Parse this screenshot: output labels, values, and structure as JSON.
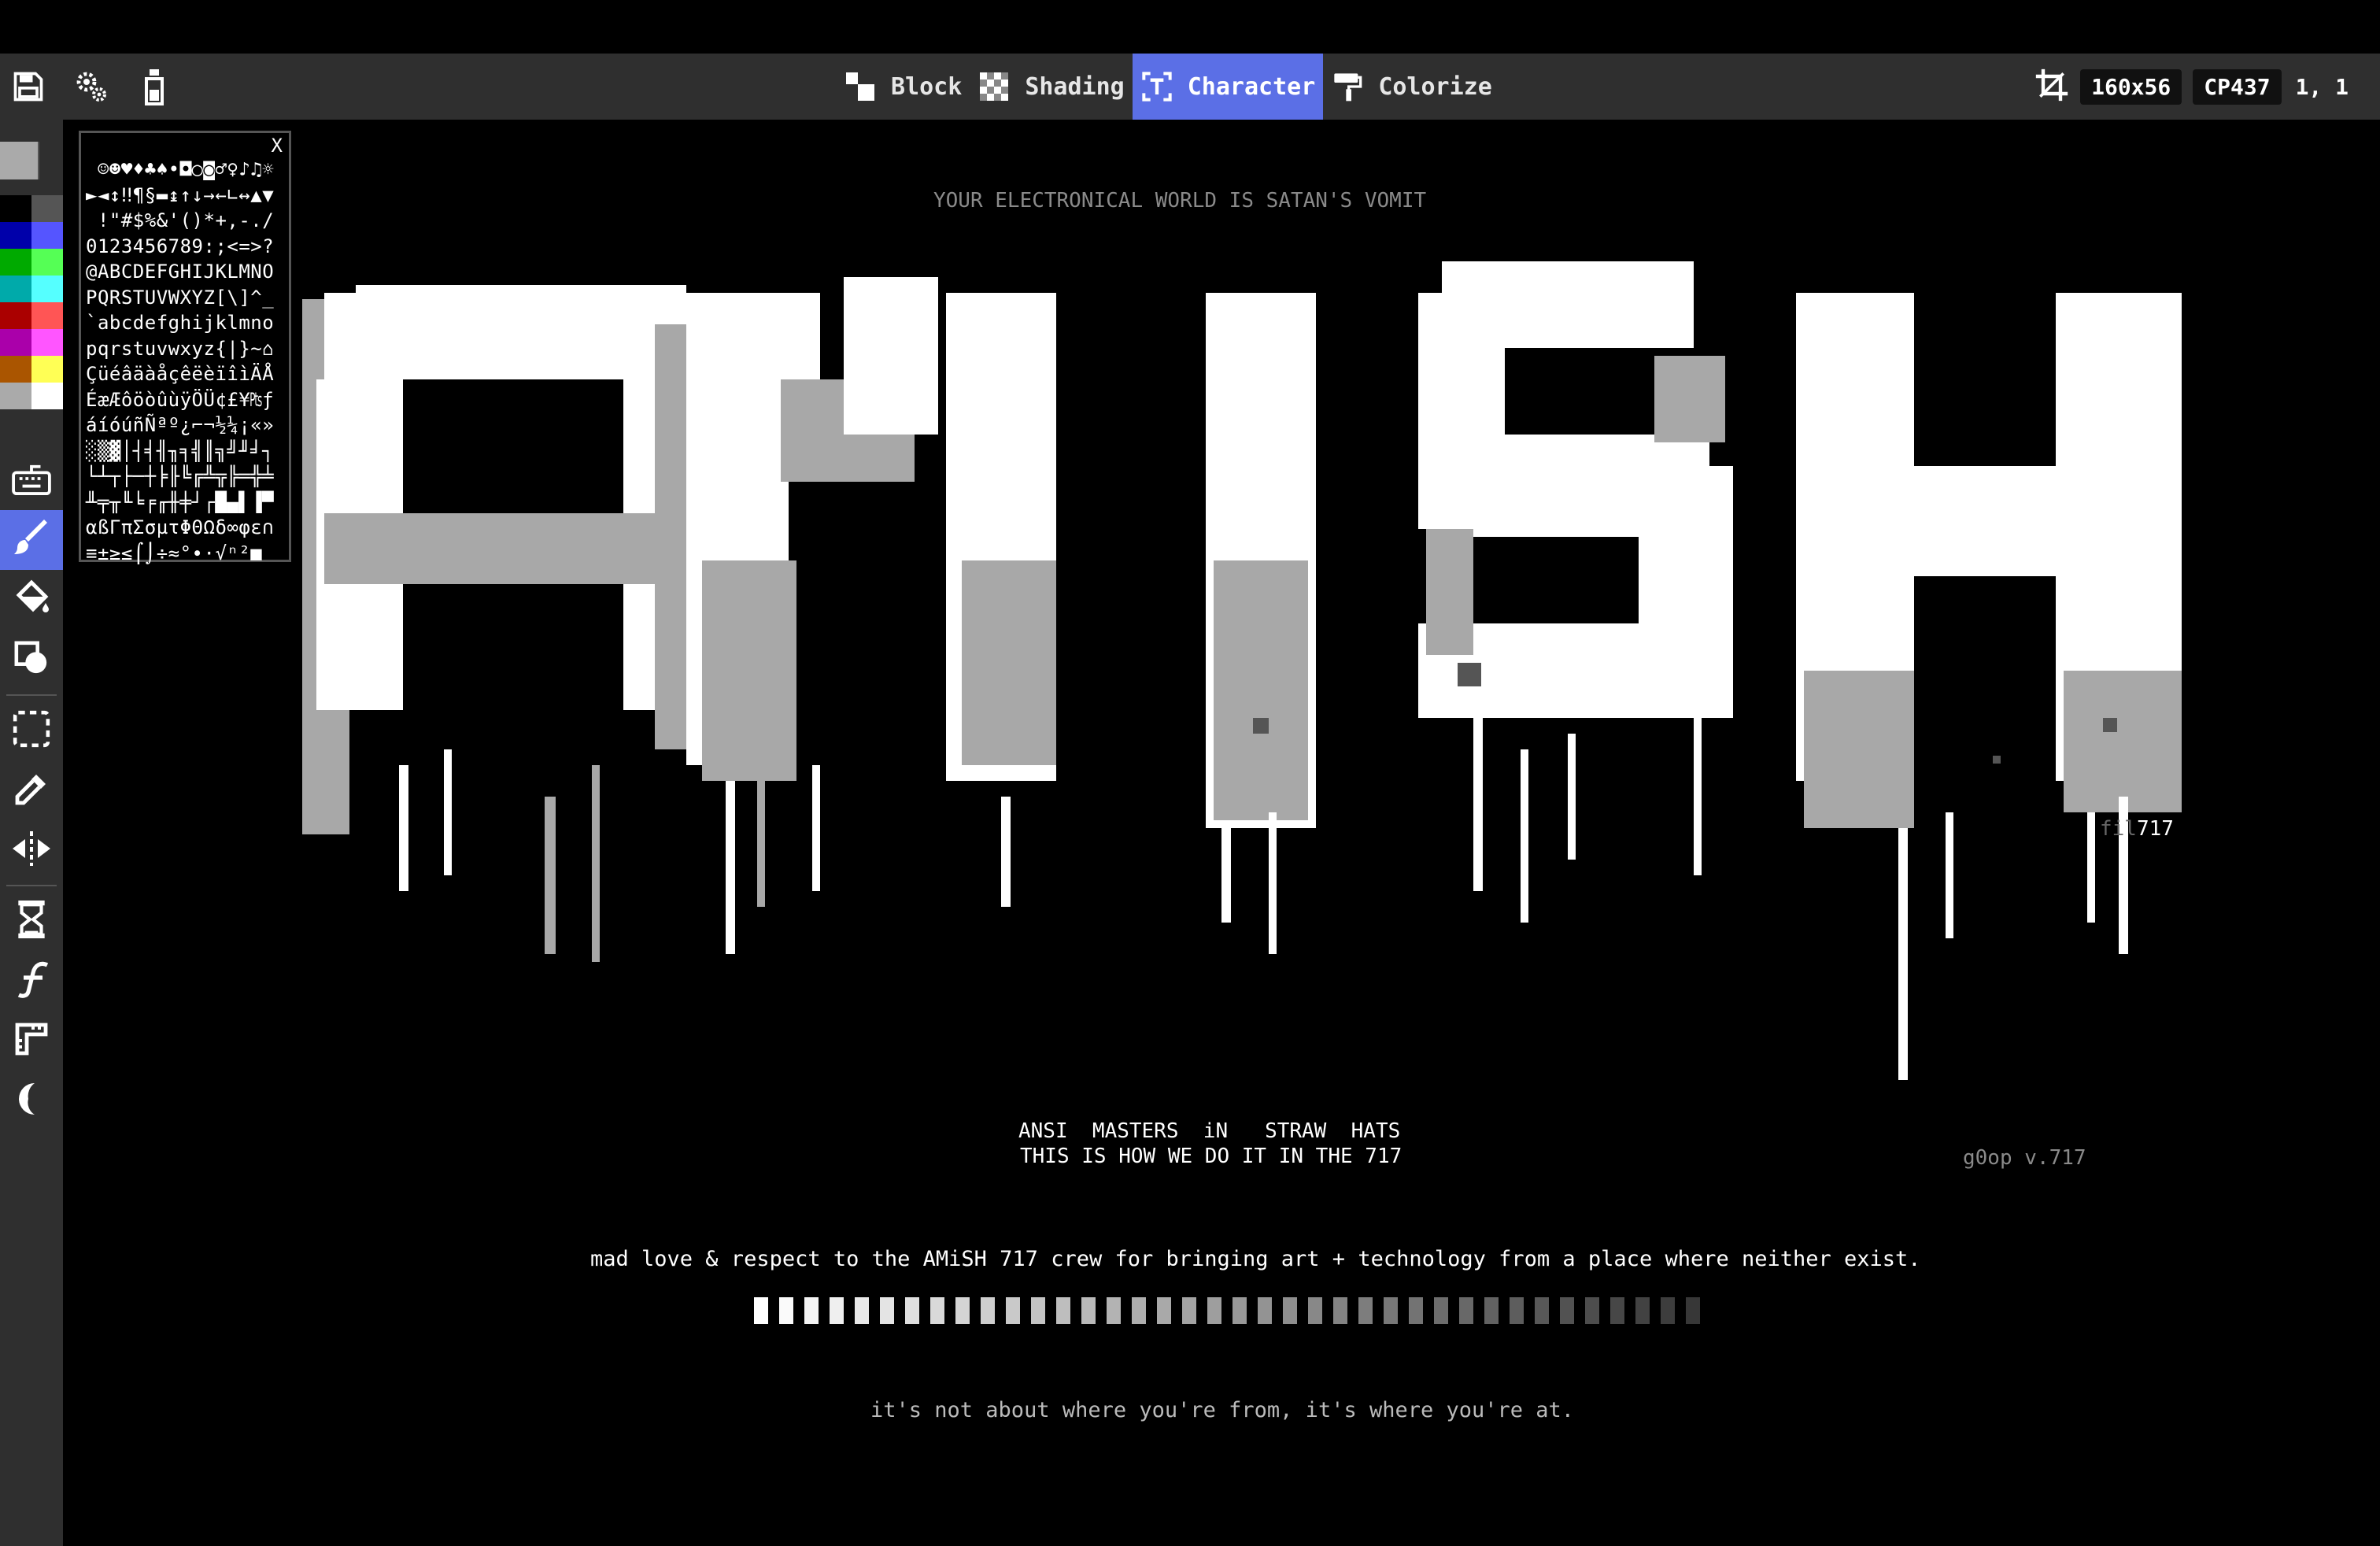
{
  "toolbar": {
    "modes": [
      {
        "label": "Block",
        "icon": "block-icon"
      },
      {
        "label": "Shading",
        "icon": "shading-icon"
      },
      {
        "label": "Character",
        "icon": "character-icon",
        "active": true
      },
      {
        "label": "Colorize",
        "icon": "colorize-icon"
      }
    ],
    "canvas_size": "160x56",
    "codepage": "CP437",
    "cursor_pos": "1, 1"
  },
  "palette": [
    "#000000",
    "#555555",
    "#0000aa",
    "#5555ff",
    "#00aa00",
    "#55ff55",
    "#00aaaa",
    "#55ffff",
    "#aa0000",
    "#ff5555",
    "#aa00aa",
    "#ff55ff",
    "#aa5500",
    "#ffff55",
    "#aaaaaa",
    "#ffffff"
  ],
  "char_picker": {
    "close_label": "X",
    "rows": [
      " ☺☻♥♦♣♠•◘○◙♂♀♪♫☼",
      "►◄↕‼¶§▬↨↑↓→←∟↔▲▼",
      " !\"#$%&'()*+,-./",
      "0123456789:;<=>?",
      "@ABCDEFGHIJKLMNO",
      "PQRSTUVWXYZ[\\]^_",
      "`abcdefghijklmno",
      "pqrstuvwxyz{|}~⌂",
      "ÇüéâäàåçêëèïîìÄÅ",
      "ÉæÆôöòûùÿÖÜ¢£¥₧ƒ",
      "áíóúñÑªº¿⌐¬½¼¡«»",
      "░▒▓│┤╡╢╖╕╣║╗╝╜╛┐",
      "└┴┬├─┼╞╟╚╔╩╦╠═╬╧",
      "╨╤╥╙╘╒╓╫╪┘┌█▄▌▐▀",
      "αßΓπΣσµτΦΘΩδ∞φε∩",
      "≡±≥≤⌠⌡÷≈°∙·√ⁿ²■ "
    ]
  },
  "art": {
    "tagline_top": "YOUR ELECTRONICAL WORLD IS SATAN'S VOMIT",
    "artist_prefix": "fil",
    "artist_suffix": "717",
    "subtitle_1": "ANSI  MASTERS  iN   STRAW  HATS",
    "subtitle_2": "THIS IS HOW WE DO IT IN THE 717",
    "signature": "g0op v.717",
    "greet": "mad love & respect to the AMiSH 717 crew for bringing art + technology from a place where neither exist.",
    "footer": "it's not about where you're from, it's where you're at."
  }
}
